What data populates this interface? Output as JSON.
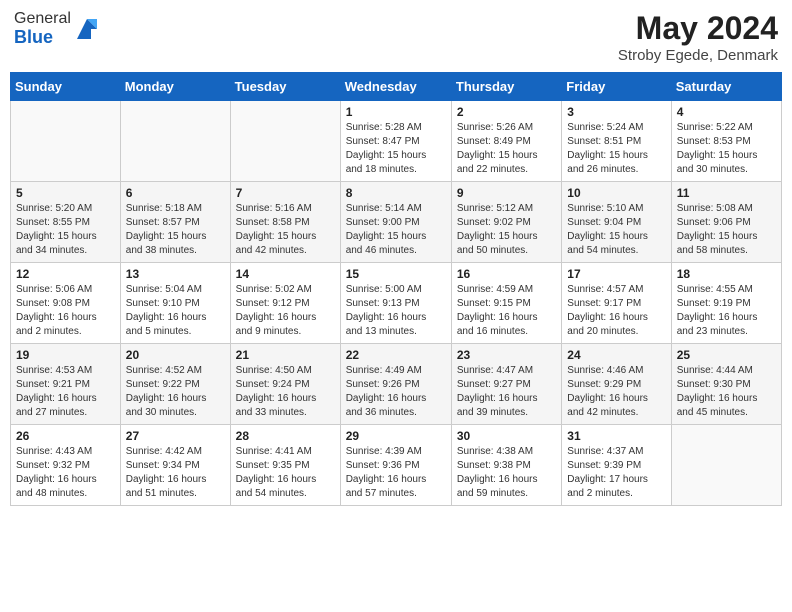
{
  "header": {
    "logo_general": "General",
    "logo_blue": "Blue",
    "month_year": "May 2024",
    "location": "Stroby Egede, Denmark"
  },
  "days_of_week": [
    "Sunday",
    "Monday",
    "Tuesday",
    "Wednesday",
    "Thursday",
    "Friday",
    "Saturday"
  ],
  "weeks": [
    [
      {
        "day": "",
        "info": ""
      },
      {
        "day": "",
        "info": ""
      },
      {
        "day": "",
        "info": ""
      },
      {
        "day": "1",
        "info": "Sunrise: 5:28 AM\nSunset: 8:47 PM\nDaylight: 15 hours\nand 18 minutes."
      },
      {
        "day": "2",
        "info": "Sunrise: 5:26 AM\nSunset: 8:49 PM\nDaylight: 15 hours\nand 22 minutes."
      },
      {
        "day": "3",
        "info": "Sunrise: 5:24 AM\nSunset: 8:51 PM\nDaylight: 15 hours\nand 26 minutes."
      },
      {
        "day": "4",
        "info": "Sunrise: 5:22 AM\nSunset: 8:53 PM\nDaylight: 15 hours\nand 30 minutes."
      }
    ],
    [
      {
        "day": "5",
        "info": "Sunrise: 5:20 AM\nSunset: 8:55 PM\nDaylight: 15 hours\nand 34 minutes."
      },
      {
        "day": "6",
        "info": "Sunrise: 5:18 AM\nSunset: 8:57 PM\nDaylight: 15 hours\nand 38 minutes."
      },
      {
        "day": "7",
        "info": "Sunrise: 5:16 AM\nSunset: 8:58 PM\nDaylight: 15 hours\nand 42 minutes."
      },
      {
        "day": "8",
        "info": "Sunrise: 5:14 AM\nSunset: 9:00 PM\nDaylight: 15 hours\nand 46 minutes."
      },
      {
        "day": "9",
        "info": "Sunrise: 5:12 AM\nSunset: 9:02 PM\nDaylight: 15 hours\nand 50 minutes."
      },
      {
        "day": "10",
        "info": "Sunrise: 5:10 AM\nSunset: 9:04 PM\nDaylight: 15 hours\nand 54 minutes."
      },
      {
        "day": "11",
        "info": "Sunrise: 5:08 AM\nSunset: 9:06 PM\nDaylight: 15 hours\nand 58 minutes."
      }
    ],
    [
      {
        "day": "12",
        "info": "Sunrise: 5:06 AM\nSunset: 9:08 PM\nDaylight: 16 hours\nand 2 minutes."
      },
      {
        "day": "13",
        "info": "Sunrise: 5:04 AM\nSunset: 9:10 PM\nDaylight: 16 hours\nand 5 minutes."
      },
      {
        "day": "14",
        "info": "Sunrise: 5:02 AM\nSunset: 9:12 PM\nDaylight: 16 hours\nand 9 minutes."
      },
      {
        "day": "15",
        "info": "Sunrise: 5:00 AM\nSunset: 9:13 PM\nDaylight: 16 hours\nand 13 minutes."
      },
      {
        "day": "16",
        "info": "Sunrise: 4:59 AM\nSunset: 9:15 PM\nDaylight: 16 hours\nand 16 minutes."
      },
      {
        "day": "17",
        "info": "Sunrise: 4:57 AM\nSunset: 9:17 PM\nDaylight: 16 hours\nand 20 minutes."
      },
      {
        "day": "18",
        "info": "Sunrise: 4:55 AM\nSunset: 9:19 PM\nDaylight: 16 hours\nand 23 minutes."
      }
    ],
    [
      {
        "day": "19",
        "info": "Sunrise: 4:53 AM\nSunset: 9:21 PM\nDaylight: 16 hours\nand 27 minutes."
      },
      {
        "day": "20",
        "info": "Sunrise: 4:52 AM\nSunset: 9:22 PM\nDaylight: 16 hours\nand 30 minutes."
      },
      {
        "day": "21",
        "info": "Sunrise: 4:50 AM\nSunset: 9:24 PM\nDaylight: 16 hours\nand 33 minutes."
      },
      {
        "day": "22",
        "info": "Sunrise: 4:49 AM\nSunset: 9:26 PM\nDaylight: 16 hours\nand 36 minutes."
      },
      {
        "day": "23",
        "info": "Sunrise: 4:47 AM\nSunset: 9:27 PM\nDaylight: 16 hours\nand 39 minutes."
      },
      {
        "day": "24",
        "info": "Sunrise: 4:46 AM\nSunset: 9:29 PM\nDaylight: 16 hours\nand 42 minutes."
      },
      {
        "day": "25",
        "info": "Sunrise: 4:44 AM\nSunset: 9:30 PM\nDaylight: 16 hours\nand 45 minutes."
      }
    ],
    [
      {
        "day": "26",
        "info": "Sunrise: 4:43 AM\nSunset: 9:32 PM\nDaylight: 16 hours\nand 48 minutes."
      },
      {
        "day": "27",
        "info": "Sunrise: 4:42 AM\nSunset: 9:34 PM\nDaylight: 16 hours\nand 51 minutes."
      },
      {
        "day": "28",
        "info": "Sunrise: 4:41 AM\nSunset: 9:35 PM\nDaylight: 16 hours\nand 54 minutes."
      },
      {
        "day": "29",
        "info": "Sunrise: 4:39 AM\nSunset: 9:36 PM\nDaylight: 16 hours\nand 57 minutes."
      },
      {
        "day": "30",
        "info": "Sunrise: 4:38 AM\nSunset: 9:38 PM\nDaylight: 16 hours\nand 59 minutes."
      },
      {
        "day": "31",
        "info": "Sunrise: 4:37 AM\nSunset: 9:39 PM\nDaylight: 17 hours\nand 2 minutes."
      },
      {
        "day": "",
        "info": ""
      }
    ]
  ]
}
